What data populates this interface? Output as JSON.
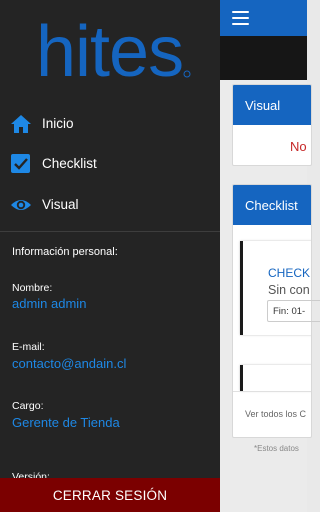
{
  "app": {
    "visual_card": {
      "title": "Visual",
      "body": "No"
    },
    "checklist_card": {
      "title": "Checklist",
      "item": {
        "title": "CHECK",
        "subtitle": "Sin con",
        "fin": "Fin: 01-"
      },
      "footer": "Ver todos los C"
    },
    "note": "*Estos datos"
  },
  "drawer": {
    "brand": "hites",
    "nav": [
      {
        "label": "Inicio",
        "icon": "home-icon"
      },
      {
        "label": "Checklist",
        "icon": "checkbox-icon"
      },
      {
        "label": "Visual",
        "icon": "eye-icon"
      }
    ],
    "info": {
      "heading": "Información personal:",
      "nombre_label": "Nombre:",
      "nombre_value": "admin admin",
      "email_label": "E-mail:",
      "email_value": "contacto@andain.cl",
      "cargo_label": "Cargo:",
      "cargo_value": "Gerente de Tienda",
      "version_label": "Versión:"
    },
    "logout_label": "CERRAR SESIÓN"
  },
  "colors": {
    "brand_blue": "#1565c0",
    "link_blue": "#1e88e5",
    "drawer_bg": "#242424",
    "logout_red": "#7b0000"
  }
}
